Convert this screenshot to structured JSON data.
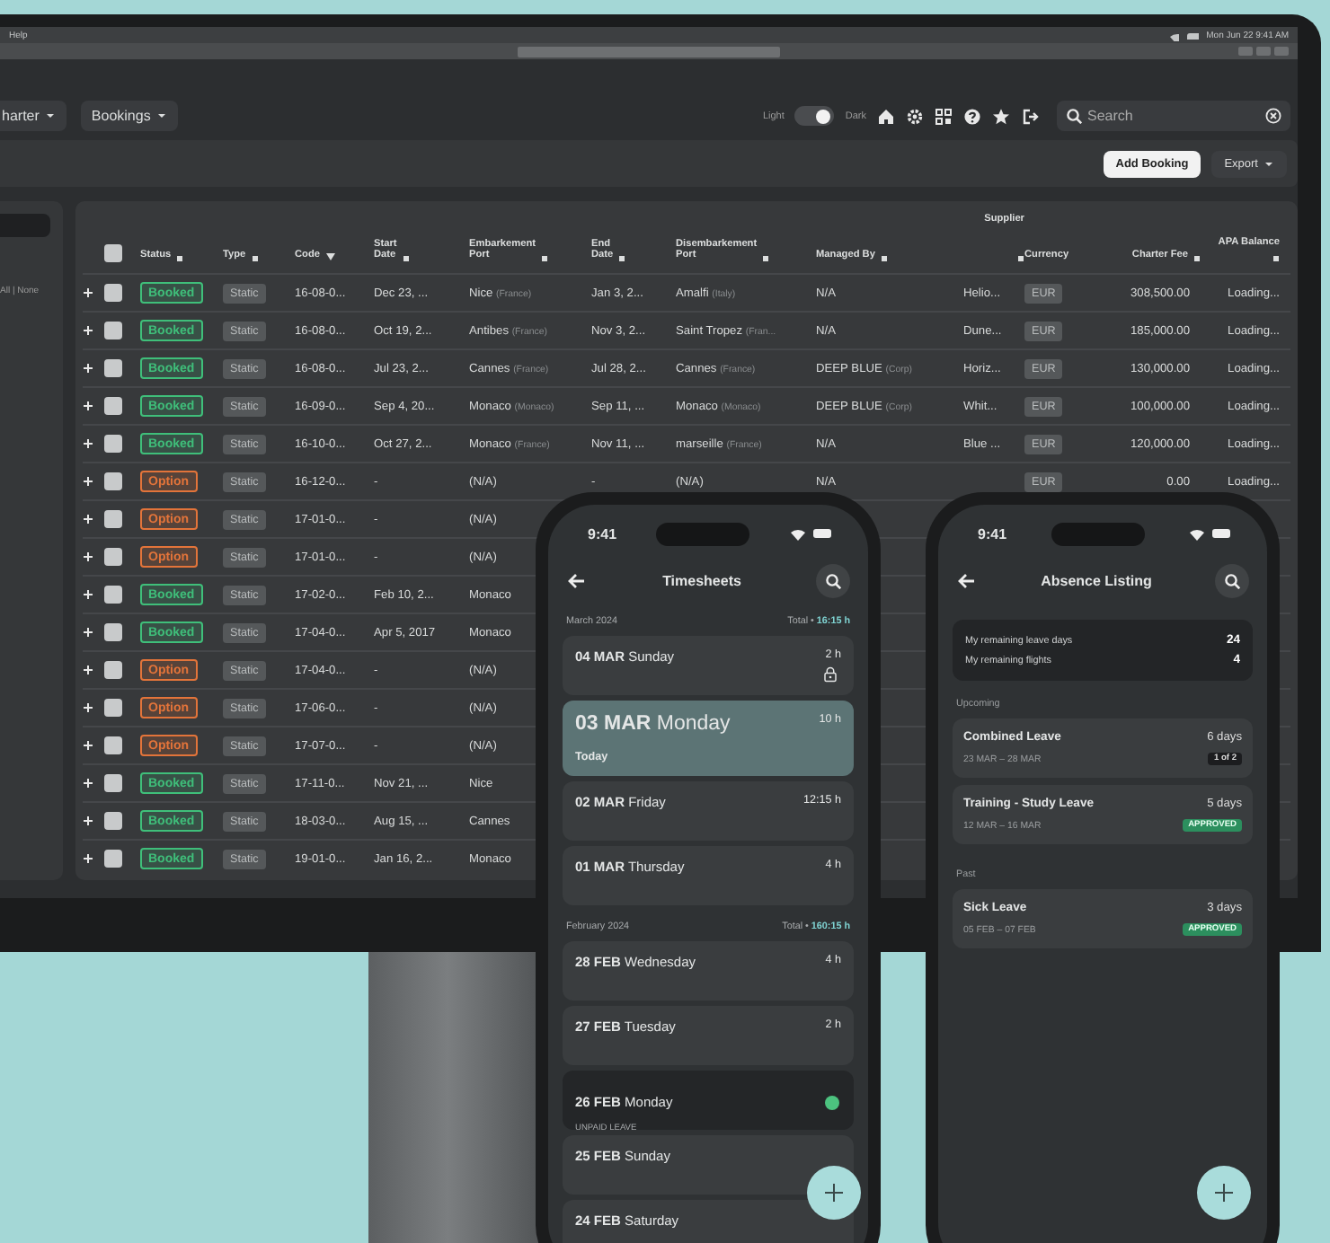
{
  "menubar": {
    "menu": "Help",
    "clock": "Mon Jun 22 9:41 AM"
  },
  "nav": {
    "menus": [
      {
        "label": "harter"
      },
      {
        "label": "Bookings"
      }
    ],
    "theme": {
      "light_label": "Light",
      "dark_label": "Dark",
      "dark": true
    },
    "search": {
      "placeholder": "Search"
    }
  },
  "actions": {
    "buttons": [
      {
        "label": "Add Booking",
        "kind": "primary"
      },
      {
        "label": "Export",
        "kind": "menu"
      }
    ]
  },
  "sidebar": {
    "select_links": "All | None"
  },
  "table": {
    "select_all_checked": false,
    "columns": [
      {
        "label": "Status",
        "kind": "sortable"
      },
      {
        "label": "Type",
        "kind": "sortable"
      },
      {
        "label": "Code",
        "kind": "sorted"
      },
      {
        "label": "Start Date",
        "kind": "sortable"
      },
      {
        "label": "Embarkement Port",
        "kind": "sortable"
      },
      {
        "label": "End Date",
        "kind": "sortable"
      },
      {
        "label": "Disembarkement Port",
        "kind": "sortable"
      },
      {
        "label": "Managed By",
        "kind": "sortable"
      },
      {
        "label": "Supplier",
        "kind": "sortable"
      },
      {
        "label": "Currency",
        "kind": "plain"
      },
      {
        "label": "Charter Fee",
        "kind": "sortable"
      },
      {
        "label": "APA Balance",
        "kind": "sortable"
      }
    ],
    "rows": [
      {
        "checked": false,
        "cells": [
          {
            "text": "Booked",
            "color": "#3fbf7a"
          },
          "Static",
          "16-08-0...",
          "Dec 23, ...",
          {
            "text": "Nice",
            "note": "(France)"
          },
          "Jan 3, 2...",
          {
            "text": "Amalfi",
            "note": "(Italy)"
          },
          "N/A",
          "Helio...",
          "EUR",
          "308,500.00",
          "Loading..."
        ]
      },
      {
        "checked": false,
        "cells": [
          {
            "text": "Booked",
            "color": "#3fbf7a"
          },
          "Static",
          "16-08-0...",
          "Oct 19, 2...",
          {
            "text": "Antibes",
            "note": "(France)"
          },
          "Nov 3, 2...",
          {
            "text": "Saint Tropez",
            "note": "(Fran..."
          },
          "N/A",
          "Dune...",
          "EUR",
          "185,000.00",
          "Loading..."
        ]
      },
      {
        "checked": false,
        "cells": [
          {
            "text": "Booked",
            "color": "#3fbf7a"
          },
          "Static",
          "16-08-0...",
          "Jul 23, 2...",
          {
            "text": "Cannes",
            "note": "(France)"
          },
          "Jul 28, 2...",
          {
            "text": "Cannes",
            "note": "(France)"
          },
          {
            "text": "DEEP BLUE",
            "note": "(Corp)"
          },
          "Horiz...",
          "EUR",
          "130,000.00",
          "Loading..."
        ]
      },
      {
        "checked": false,
        "cells": [
          {
            "text": "Booked",
            "color": "#3fbf7a"
          },
          "Static",
          "16-09-0...",
          "Sep 4, 20...",
          {
            "text": "Monaco",
            "note": "(Monaco)"
          },
          "Sep 11, ...",
          {
            "text": "Monaco",
            "note": "(Monaco)"
          },
          {
            "text": "DEEP BLUE",
            "note": "(Corp)"
          },
          "Whit...",
          "EUR",
          "100,000.00",
          "Loading..."
        ]
      },
      {
        "checked": false,
        "cells": [
          {
            "text": "Booked",
            "color": "#3fbf7a"
          },
          "Static",
          "16-10-0...",
          "Oct 27, 2...",
          {
            "text": "Monaco",
            "note": "(France)"
          },
          "Nov 11, ...",
          {
            "text": "marseille",
            "note": "(France)"
          },
          "N/A",
          "Blue ...",
          "EUR",
          "120,000.00",
          "Loading..."
        ]
      },
      {
        "checked": false,
        "cells": [
          {
            "text": "Option",
            "color": "#e3743a"
          },
          "Static",
          "16-12-0...",
          "-",
          "(N/A)",
          "-",
          "(N/A)",
          "N/A",
          null,
          "EUR",
          "0.00",
          "Loading..."
        ]
      },
      {
        "checked": false,
        "cells": [
          {
            "text": "Option",
            "color": "#e3743a"
          },
          "Static",
          "17-01-0...",
          "-",
          "(N/A)"
        ]
      },
      {
        "checked": false,
        "cells": [
          {
            "text": "Option",
            "color": "#e3743a"
          },
          "Static",
          "17-01-0...",
          "-",
          "(N/A)"
        ]
      },
      {
        "checked": false,
        "cells": [
          {
            "text": "Booked",
            "color": "#3fbf7a"
          },
          "Static",
          "17-02-0...",
          "Feb 10, 2...",
          "Monaco"
        ]
      },
      {
        "checked": false,
        "cells": [
          {
            "text": "Booked",
            "color": "#3fbf7a"
          },
          "Static",
          "17-04-0...",
          "Apr 5, 2017",
          "Monaco"
        ]
      },
      {
        "checked": false,
        "cells": [
          {
            "text": "Option",
            "color": "#e3743a"
          },
          "Static",
          "17-04-0...",
          "-",
          "(N/A)"
        ]
      },
      {
        "checked": false,
        "cells": [
          {
            "text": "Option",
            "color": "#e3743a"
          },
          "Static",
          "17-06-0...",
          "-",
          "(N/A)"
        ]
      },
      {
        "checked": false,
        "cells": [
          {
            "text": "Option",
            "color": "#e3743a"
          },
          "Static",
          "17-07-0...",
          "-",
          "(N/A)"
        ]
      },
      {
        "checked": false,
        "cells": [
          {
            "text": "Booked",
            "color": "#3fbf7a"
          },
          "Static",
          "17-11-0...",
          "Nov 21, ...",
          "Nice"
        ]
      },
      {
        "checked": false,
        "cells": [
          {
            "text": "Booked",
            "color": "#3fbf7a"
          },
          "Static",
          "18-03-0...",
          "Aug 15, ...",
          "Cannes"
        ]
      },
      {
        "checked": false,
        "cells": [
          {
            "text": "Booked",
            "color": "#3fbf7a"
          },
          "Static",
          "19-01-0...",
          "Jan 16, 2...",
          "Monaco"
        ]
      }
    ]
  },
  "timesheets": {
    "time": "9:41",
    "title": "Timesheets",
    "sections": [
      {
        "month": "March 2024",
        "total_label": "Total •",
        "total": "16:15 h",
        "items": [
          {
            "date": "04 MAR",
            "day": "Sunday",
            "hours": "2 h",
            "kind": "entry",
            "locked": true
          },
          {
            "date": "03 MAR",
            "day": "Monday",
            "hours": "10 h",
            "kind": "today",
            "note": "Today",
            "locked": false
          },
          {
            "date": "02 MAR",
            "day": "Friday",
            "hours": "12:15 h",
            "kind": "entry",
            "locked": false
          },
          {
            "date": "01 MAR",
            "day": "Thursday",
            "hours": "4 h",
            "kind": "entry",
            "locked": false
          }
        ]
      },
      {
        "month": "February 2024",
        "total_label": "Total •",
        "total": "160:15 h",
        "items": [
          {
            "date": "28 FEB",
            "day": "Wednesday",
            "hours": "4 h",
            "kind": "entry",
            "locked": false
          },
          {
            "date": "27 FEB",
            "day": "Tuesday",
            "hours": "2 h",
            "kind": "entry",
            "locked": false
          },
          {
            "date": "26 FEB",
            "day": "Monday",
            "kind": "leave",
            "note": "UNPAID LEAVE",
            "color": "#4cc27f",
            "locked": false
          },
          {
            "date": "25 FEB",
            "day": "Sunday",
            "kind": "entry",
            "locked": false
          },
          {
            "date": "24 FEB",
            "day": "Saturday",
            "kind": "entry",
            "locked": false
          }
        ]
      }
    ]
  },
  "absence": {
    "time": "9:41",
    "title": "Absence Listing",
    "summary": [
      {
        "label": "My remaining leave days",
        "value": "24"
      },
      {
        "label": "My remaining flights",
        "value": "4"
      }
    ],
    "sections": [
      {
        "label": "Upcoming",
        "items": [
          {
            "title": "Combined Leave",
            "days": "6 days",
            "dates": "23 MAR – 28 MAR",
            "badge": {
              "text": "1 of 2",
              "kind": "count"
            }
          },
          {
            "title": "Training - Study Leave",
            "days": "5 days",
            "dates": "12 MAR – 16 MAR",
            "badge": {
              "text": "APPROVED",
              "kind": "approved"
            }
          }
        ]
      },
      {
        "label": "Past",
        "items": [
          {
            "title": "Sick Leave",
            "days": "3 days",
            "dates": "05 FEB – 07 FEB",
            "badge": {
              "text": "APPROVED",
              "kind": "approved"
            }
          }
        ]
      }
    ]
  }
}
